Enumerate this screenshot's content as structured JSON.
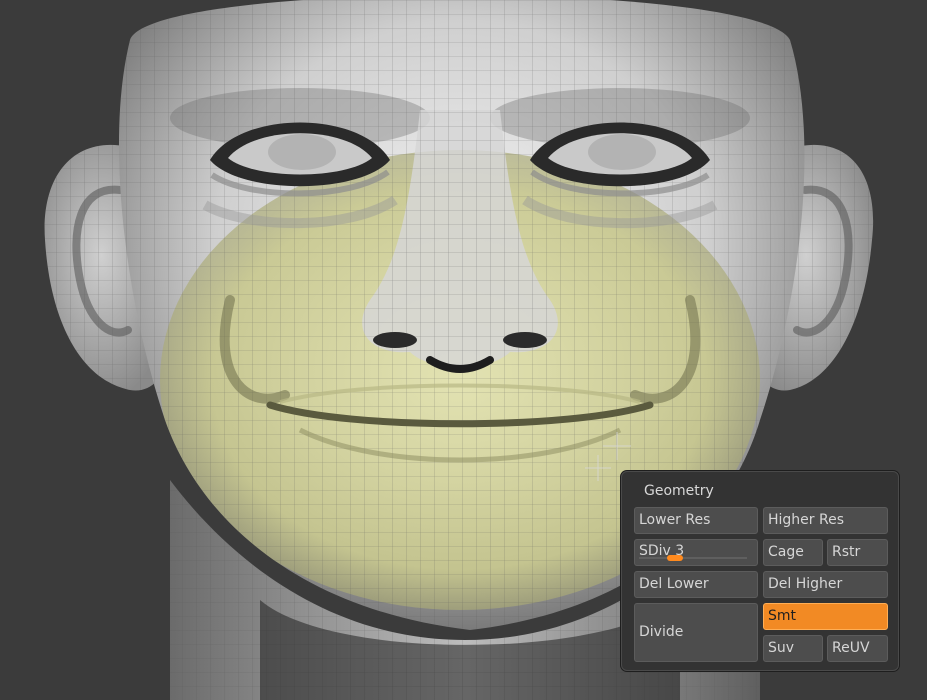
{
  "viewport": {
    "background_color": "#3b3b3b",
    "skin_color": "#d9d9d9",
    "mask_color": "#dcdca0",
    "wire_color": "#555555",
    "cursor_icon": "crosshair-icon"
  },
  "geometry_panel": {
    "title": "Geometry",
    "lower_res": "Lower Res",
    "higher_res": "Higher Res",
    "sdiv_label": "SDiv 3",
    "sdiv_value": 3,
    "cage": "Cage",
    "rstr": "Rstr",
    "del_lower": "Del Lower",
    "del_higher": "Del Higher",
    "divide": "Divide",
    "smt": "Smt",
    "suv": "Suv",
    "reuv": "ReUV",
    "active_color": "#f28a24"
  }
}
